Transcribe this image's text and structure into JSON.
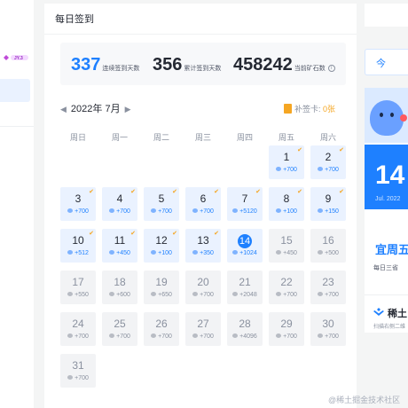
{
  "header": {
    "title": "每日签到"
  },
  "stats": {
    "consecutive_value": "337",
    "consecutive_label": "连续签到天数",
    "total_value": "356",
    "total_label": "累计签到天数",
    "ore_value": "458242",
    "ore_label": "当前矿石数",
    "info_icon": "i"
  },
  "calendar": {
    "prev_icon": "◀",
    "month_label": "2022年 7月",
    "next_icon": "▶",
    "makeup_label": "补签卡:",
    "makeup_count": "0张",
    "weekdays": [
      "周日",
      "周一",
      "周二",
      "周三",
      "周四",
      "周五",
      "周六"
    ],
    "check_icon": "✔",
    "days": [
      {
        "day": "1",
        "points": "+700",
        "status": "signed"
      },
      {
        "day": "2",
        "points": "+700",
        "status": "signed"
      },
      {
        "day": "3",
        "points": "+700",
        "status": "signed"
      },
      {
        "day": "4",
        "points": "+700",
        "status": "signed"
      },
      {
        "day": "5",
        "points": "+700",
        "status": "signed"
      },
      {
        "day": "6",
        "points": "+700",
        "status": "signed"
      },
      {
        "day": "7",
        "points": "+5120",
        "status": "signed"
      },
      {
        "day": "8",
        "points": "+100",
        "status": "signed"
      },
      {
        "day": "9",
        "points": "+150",
        "status": "signed"
      },
      {
        "day": "10",
        "points": "+512",
        "status": "signed"
      },
      {
        "day": "11",
        "points": "+450",
        "status": "signed"
      },
      {
        "day": "12",
        "points": "+100",
        "status": "signed"
      },
      {
        "day": "13",
        "points": "+350",
        "status": "signed"
      },
      {
        "day": "14",
        "points": "+1024",
        "status": "today"
      },
      {
        "day": "15",
        "points": "+450",
        "status": "future"
      },
      {
        "day": "16",
        "points": "+500",
        "status": "future"
      },
      {
        "day": "17",
        "points": "+550",
        "status": "future"
      },
      {
        "day": "18",
        "points": "+600",
        "status": "future"
      },
      {
        "day": "19",
        "points": "+650",
        "status": "future"
      },
      {
        "day": "20",
        "points": "+700",
        "status": "future"
      },
      {
        "day": "21",
        "points": "+2048",
        "status": "future"
      },
      {
        "day": "22",
        "points": "+700",
        "status": "future"
      },
      {
        "day": "23",
        "points": "+700",
        "status": "future"
      },
      {
        "day": "24",
        "points": "+700",
        "status": "future"
      },
      {
        "day": "25",
        "points": "+700",
        "status": "future"
      },
      {
        "day": "26",
        "points": "+700",
        "status": "future"
      },
      {
        "day": "27",
        "points": "+700",
        "status": "future"
      },
      {
        "day": "28",
        "points": "+4096",
        "status": "future"
      },
      {
        "day": "29",
        "points": "+700",
        "status": "future"
      },
      {
        "day": "30",
        "points": "+700",
        "status": "future"
      },
      {
        "day": "31",
        "points": "+700",
        "status": "future"
      }
    ]
  },
  "right_panel": {
    "button_label": "今",
    "promo_big": "14",
    "promo_small": "Jul. 2022",
    "promo_title": "宜周五",
    "promo_sub": "每日三省",
    "app_name": "稀土",
    "app_sub": "扫描右侧二维"
  },
  "watermark": "@稀土掘金技术社区",
  "colors": {
    "accent": "#1e80ff",
    "gold": "#f5a623",
    "signed_bg": "#eaf2ff",
    "future_bg": "#f2f3f5"
  }
}
